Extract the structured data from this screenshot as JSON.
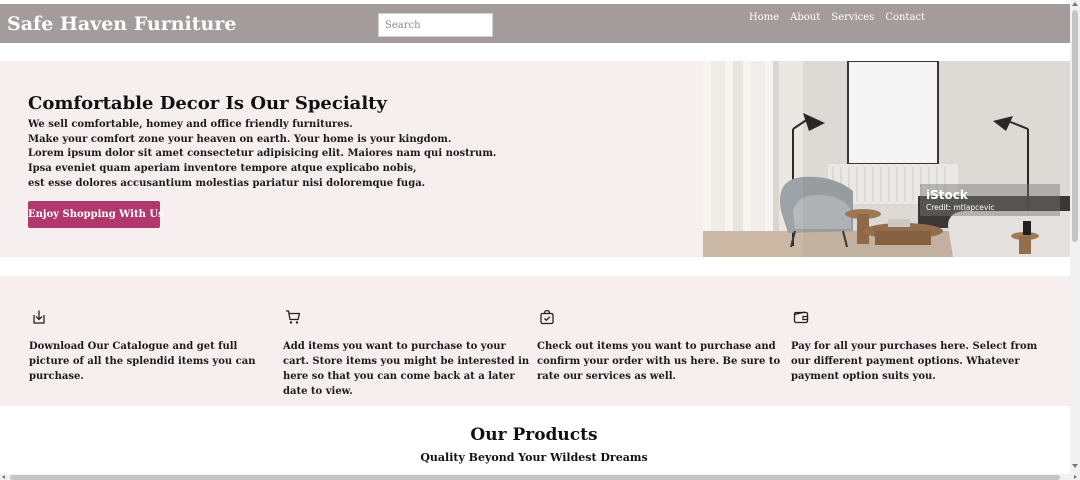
{
  "header": {
    "brand": "Safe Haven Furniture",
    "search_placeholder": "Search",
    "nav": [
      "Home",
      "About",
      "Services",
      "Contact"
    ]
  },
  "hero": {
    "title": "Comfortable Decor Is Our Specialty",
    "lines": [
      "We sell comfortable, homey and office friendly furnitures.",
      "Make your comfort zone your heaven on earth. Your home is your kingdom.",
      "Lorem ipsum dolor sit amet consectetur adipisicing elit. Maiores nam qui nostrum.",
      "Ipsa eveniet quam aperiam inventore tempore atque explicabo nobis,",
      "est esse dolores accusantium molestias pariatur nisi doloremque fuga."
    ],
    "cta_label": "Enjoy Shopping With Us",
    "image_watermark": {
      "logo": "iStock",
      "credit": "Credit: mtlapcevic"
    }
  },
  "features": [
    {
      "icon": "download-icon",
      "text": "Download Our Catalogue and get full picture of all the splendid items you can purchase."
    },
    {
      "icon": "cart-icon",
      "text": "Add items you want to purchase to your cart. Store items you might be interested in here so that you can come back at a later date to view."
    },
    {
      "icon": "bag-check-icon",
      "text": "Check out items you want to purchase and confirm your order with us here. Be sure to rate our services as well."
    },
    {
      "icon": "wallet-icon",
      "text": "Pay for all your purchases here. Select from our different payment options. Whatever payment option suits you."
    }
  ],
  "products": {
    "title": "Our Products",
    "subtitle": "Quality Beyond Your Wildest Dreams"
  },
  "colors": {
    "navbar": "#a39b9c",
    "section_bg": "#f6eeef",
    "cta": "#b0386d"
  }
}
